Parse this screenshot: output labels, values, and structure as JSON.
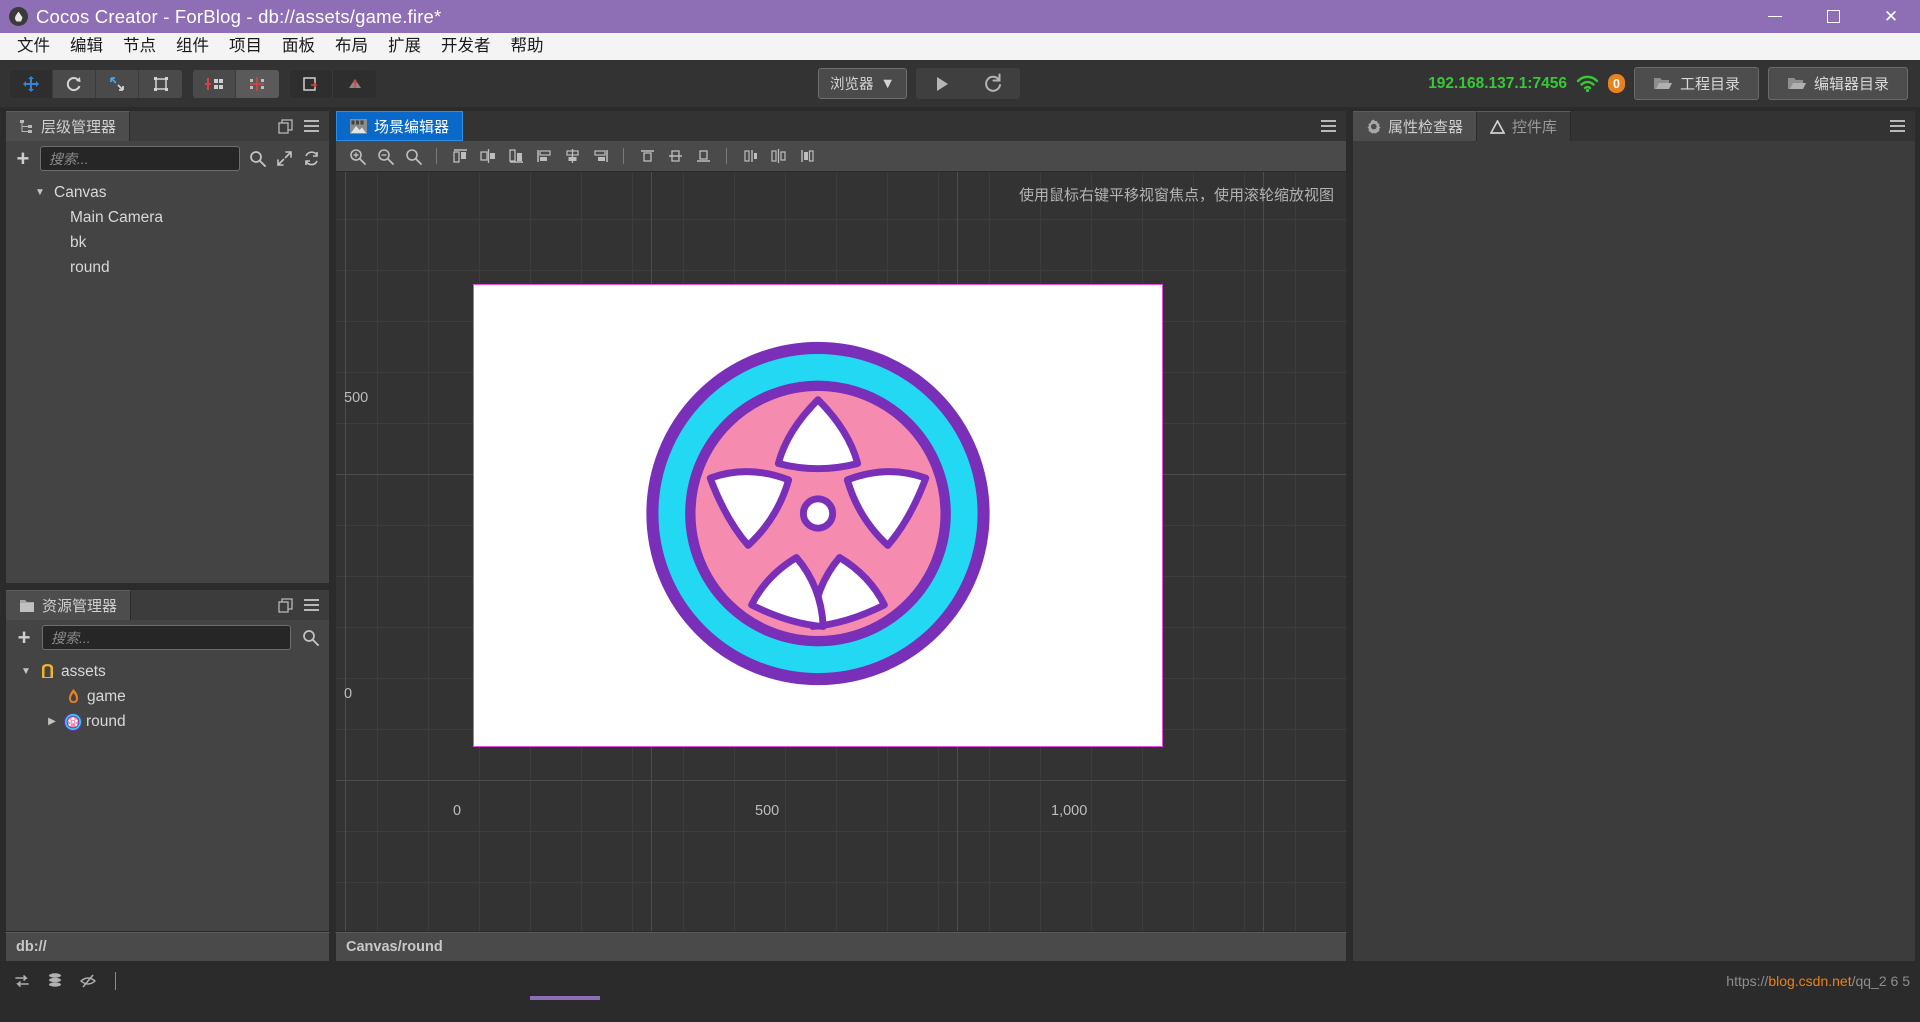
{
  "window": {
    "title": "Cocos Creator - ForBlog - db://assets/game.fire*",
    "minimize_label": "Minimize",
    "maximize_label": "Maximize",
    "close_label": "✕"
  },
  "menubar": {
    "items": [
      {
        "label": "文件"
      },
      {
        "label": "编辑"
      },
      {
        "label": "节点"
      },
      {
        "label": "组件"
      },
      {
        "label": "项目"
      },
      {
        "label": "面板"
      },
      {
        "label": "布局"
      },
      {
        "label": "扩展"
      },
      {
        "label": "开发者"
      },
      {
        "label": "帮助"
      }
    ]
  },
  "toolbar": {
    "transform_tools": [
      {
        "name": "move-tool",
        "active": true
      },
      {
        "name": "rotate-tool",
        "active": false
      },
      {
        "name": "scale-tool",
        "active": false
      },
      {
        "name": "rect-tool",
        "active": false
      }
    ],
    "pivot_tools": [
      {
        "name": "pivot-tool",
        "active": false
      },
      {
        "name": "anchor-tool",
        "active": true
      }
    ],
    "coord_tools": [
      {
        "name": "local-coord-tool",
        "active": false
      },
      {
        "name": "global-coord-tool",
        "active": true
      }
    ],
    "preview_target": "浏览器",
    "preview_caret": "▼",
    "play_label": "▶",
    "refresh_label": "⟳",
    "device_ip": "192.168.137.1:7456",
    "wifi_icon": "wifi-icon",
    "device_count": "0",
    "project_folder_label": "工程目录",
    "editor_folder_label": "编辑器目录"
  },
  "hierarchy": {
    "tab_label": "层级管理器",
    "tab_icon": "hierarchy-icon",
    "search_placeholder": "搜索...",
    "search_value": "",
    "add_label": "+",
    "tools": [
      "search-icon",
      "expand-icon",
      "refresh-icon"
    ],
    "tree": [
      {
        "label": "Canvas",
        "depth": 0,
        "expanded": true,
        "has_children": true
      },
      {
        "label": "Main Camera",
        "depth": 1,
        "expanded": false,
        "has_children": false
      },
      {
        "label": "bk",
        "depth": 1,
        "expanded": false,
        "has_children": false
      },
      {
        "label": "round",
        "depth": 1,
        "expanded": false,
        "has_children": false
      }
    ]
  },
  "assets": {
    "tab_label": "资源管理器",
    "tab_icon": "folder-icon",
    "search_placeholder": "搜索...",
    "search_value": "",
    "add_label": "+",
    "tree": [
      {
        "label": "assets",
        "depth": 0,
        "expanded": true,
        "has_children": true,
        "icon": "assets-folder-icon"
      },
      {
        "label": "game",
        "depth": 1,
        "expanded": false,
        "has_children": false,
        "icon": "scene-fire-icon"
      },
      {
        "label": "round",
        "depth": 1,
        "expanded": false,
        "has_children": true,
        "icon": "wheel-sprite-icon"
      }
    ],
    "status_path": "db://"
  },
  "scene": {
    "tab_label": "场景编辑器",
    "tab_icon": "scene-icon",
    "toolbar_icons": [
      "zoom-in-icon",
      "zoom-out-icon",
      "zoom-fit-icon",
      "align-left-icon",
      "align-center-h-icon",
      "align-right-icon",
      "distribute-left-icon",
      "distribute-center-icon",
      "distribute-right-icon",
      "align-top-icon",
      "align-middle-icon",
      "align-bottom-icon"
    ],
    "hint": "使用鼠标右键平移视窗焦点，使用滚轮缩放视图",
    "ruler_y": [
      "500",
      "0"
    ],
    "ruler_x": [
      "0",
      "500",
      "1,000"
    ],
    "selected_path": "Canvas/round",
    "canvas_border_color": "#e24fe2",
    "wheel": {
      "outline_color": "#6b2fa8",
      "tire_color": "#22d8f2",
      "hub_color": "#f58cb0",
      "spoke_gap_color": "#ffffff"
    }
  },
  "inspector": {
    "tabs": [
      {
        "label": "属性检查器",
        "icon": "gear-icon",
        "active": true
      },
      {
        "label": "控件库",
        "icon": "triangle-icon",
        "active": false
      }
    ]
  },
  "statusbar": {
    "icons": [
      "sync-icon",
      "database-icon",
      "preview-off-icon"
    ],
    "watermark_left": "https://",
    "watermark_brand": "blog.csdn.net",
    "watermark_right": "/qq_2 6 5"
  }
}
